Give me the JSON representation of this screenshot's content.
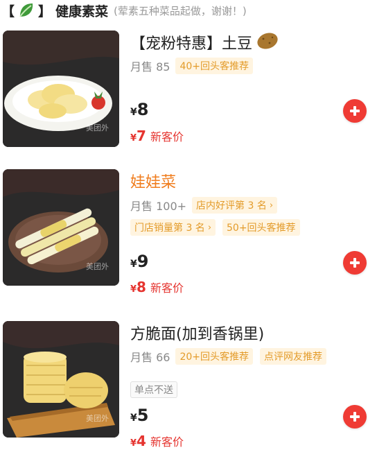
{
  "section": {
    "bracket_open": "【",
    "bracket_close": "】",
    "title": "健康素菜",
    "subtitle": "(荤素五种菜品起做，谢谢！)"
  },
  "items": [
    {
      "name": "【宠粉特惠】土豆",
      "sales": "月售 85",
      "tags": [
        "40+回头客推荐"
      ],
      "price_currency": "¥",
      "price": "8",
      "new_currency": "¥",
      "new_price": "7",
      "new_label": "新客价",
      "watermark": "美团外"
    },
    {
      "name": "娃娃菜",
      "sales": "月售 100+",
      "tags": [
        "店内好评第 3 名",
        "门店销量第 3 名",
        "50+回头客推荐"
      ],
      "price_currency": "¥",
      "price": "9",
      "new_currency": "¥",
      "new_price": "8",
      "new_label": "新客价",
      "watermark": "美团外"
    },
    {
      "name": "方脆面(加到香锅里)",
      "sales": "月售 66",
      "tags": [
        "20+回头客推荐",
        "点评网友推荐"
      ],
      "chip": "单点不送",
      "price_currency": "¥",
      "price": "5",
      "new_currency": "¥",
      "new_price": "4",
      "new_label": "新客价",
      "watermark": "美团外"
    }
  ],
  "chevron": "›"
}
